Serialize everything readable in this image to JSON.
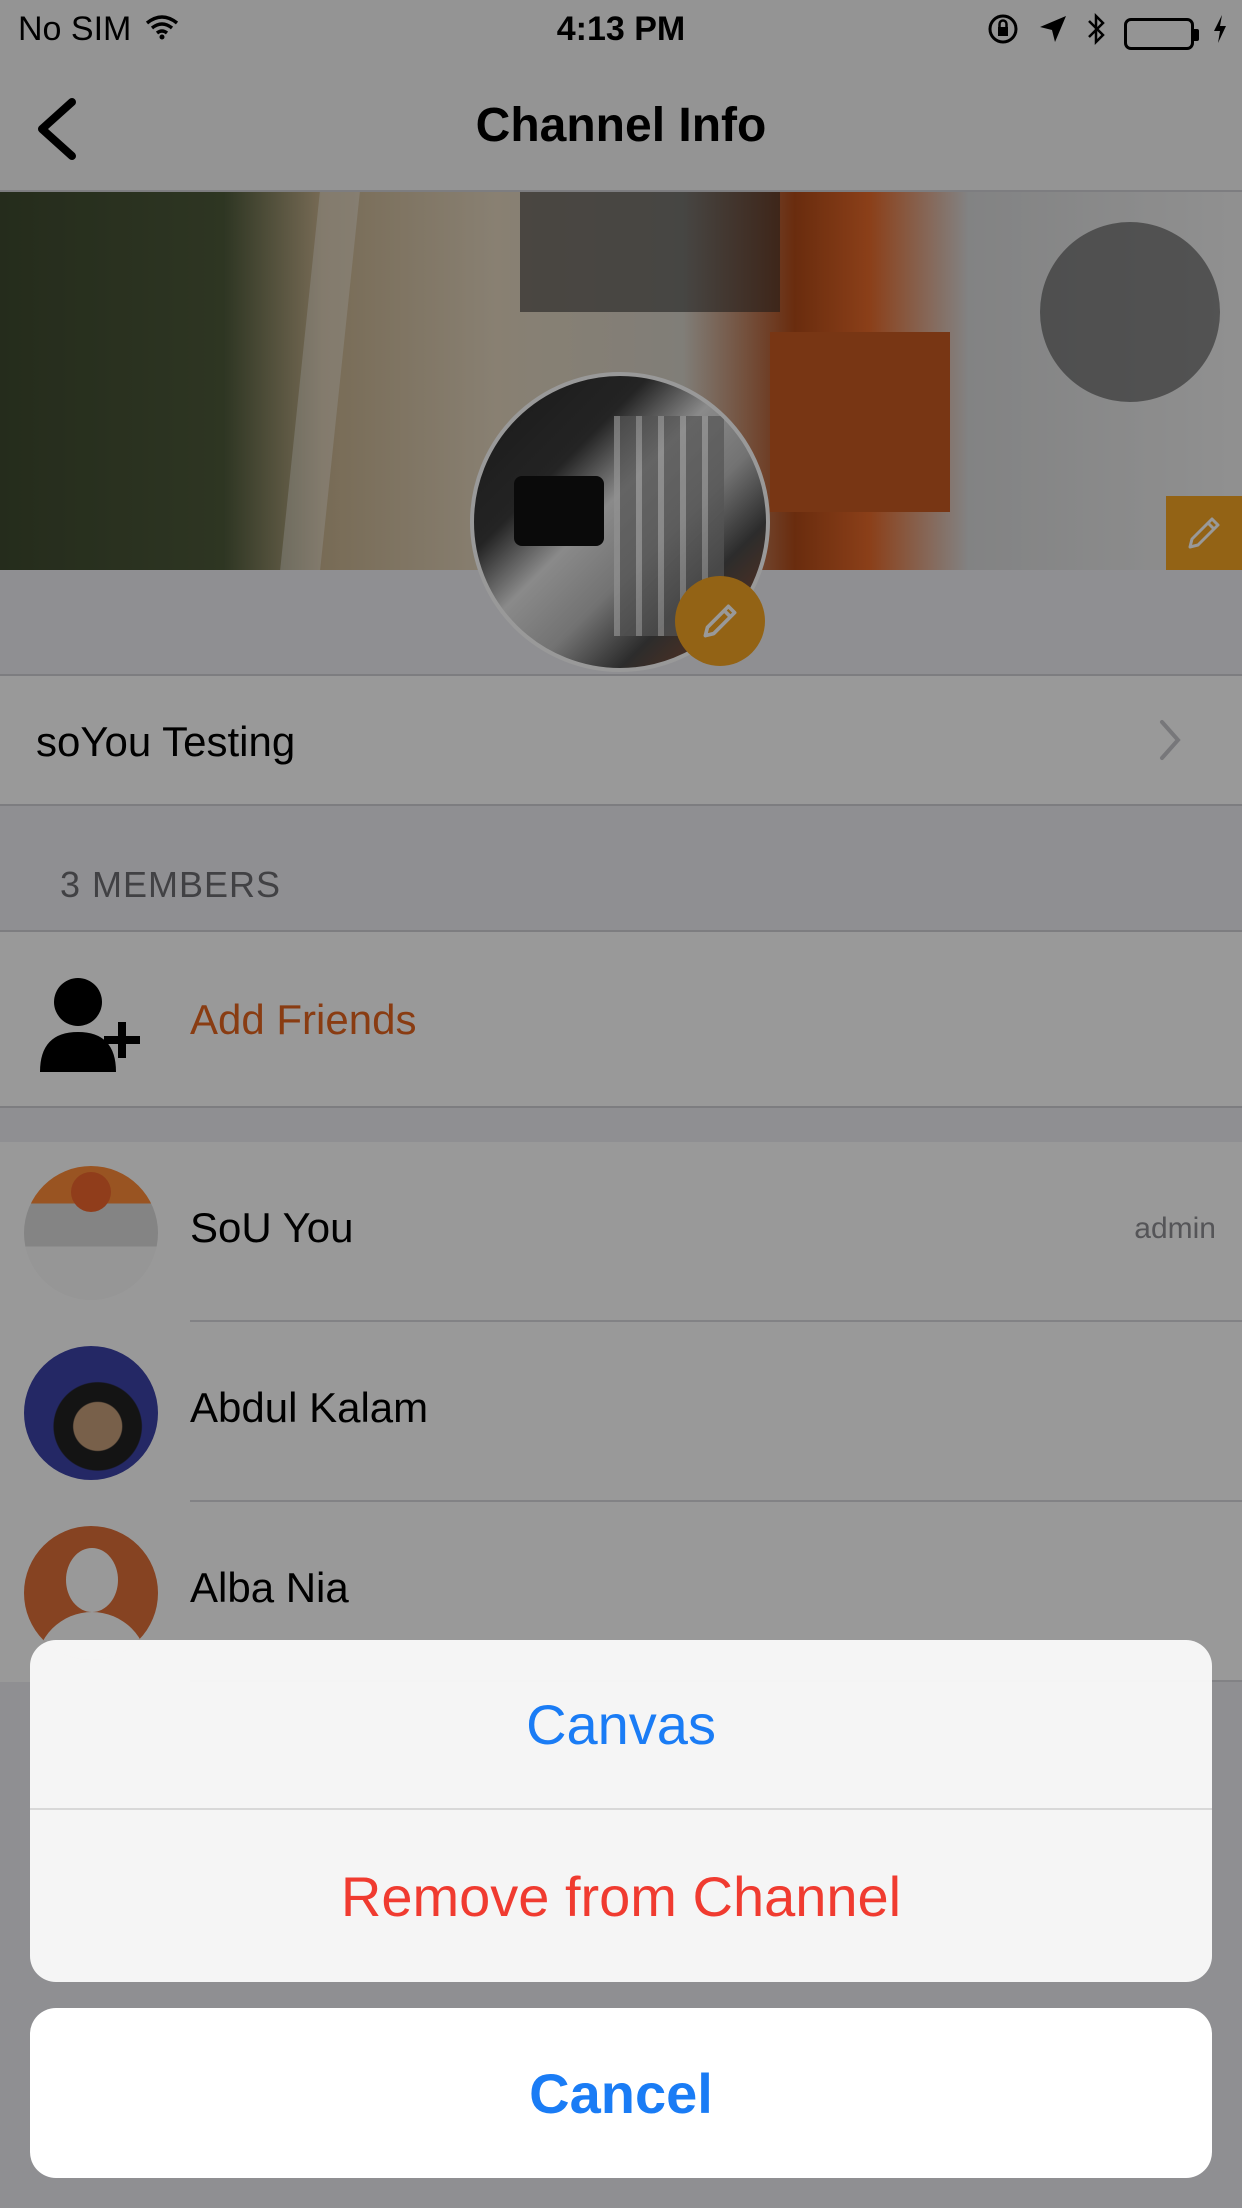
{
  "status_bar": {
    "carrier": "No SIM",
    "time": "4:13 PM",
    "battery_color": "#4cd964",
    "icons": [
      "wifi-icon",
      "orientation-lock-icon",
      "location-icon",
      "bluetooth-icon",
      "battery-icon",
      "charging-icon"
    ]
  },
  "nav": {
    "title": "Channel Info",
    "back_icon": "chevron-left-icon"
  },
  "channel": {
    "name": "soYou Testing",
    "edit_color": "#f5a623"
  },
  "members": {
    "header": "3 MEMBERS",
    "add_label": "Add Friends",
    "add_color": "#e5641e",
    "list": [
      {
        "name": "SoU You",
        "role": "admin"
      },
      {
        "name": "Abdul Kalam",
        "role": ""
      },
      {
        "name": "Alba Nia",
        "role": ""
      }
    ]
  },
  "action_sheet": {
    "option_1": "Canvas",
    "option_2": "Remove from Channel",
    "cancel": "Cancel",
    "primary_color": "#1a7cf5",
    "destructive_color": "#f03b30"
  }
}
